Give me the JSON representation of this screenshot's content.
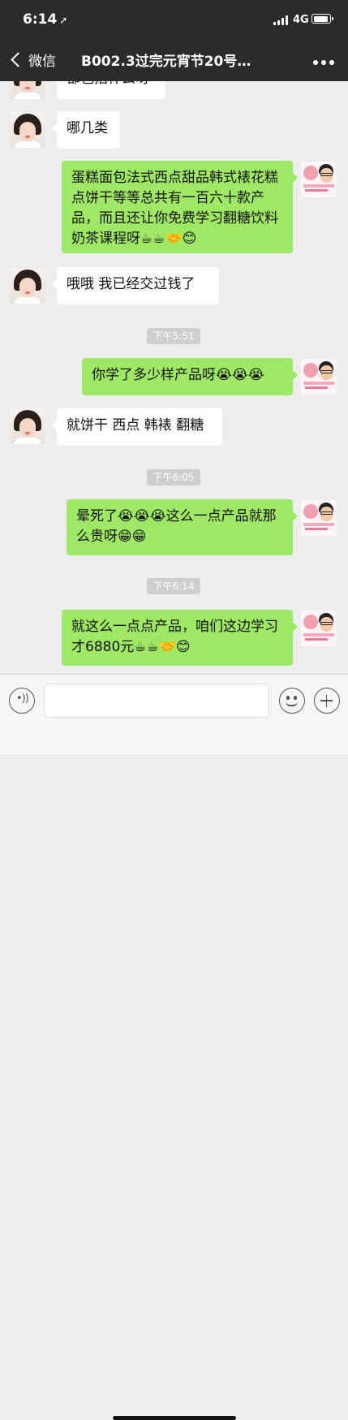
{
  "status_bar": {
    "time": "6:14",
    "network": "4G"
  },
  "nav": {
    "back_label": "微信",
    "title": "B002.3过完元宵节20号…"
  },
  "messages": [
    {
      "side": "left",
      "text": "都包括什么呀"
    },
    {
      "side": "left",
      "text": "哪几类"
    },
    {
      "side": "right",
      "text": "蛋糕面包法式西点甜品韩式裱花糕点饼干等等总共有一百六十款产品，而且还让你免费学习翻糖饮料奶茶课程呀☕☕🤝😊"
    },
    {
      "side": "left",
      "text": "哦哦  我已经交过钱了"
    },
    {
      "side": "right",
      "text": "你学了多少样产品呀😭😭😭"
    },
    {
      "side": "left",
      "text": "就饼干 西点 韩裱 翻糖"
    },
    {
      "side": "right",
      "text": "晕死了😭😭😭这么一点产品就那么贵呀😁😁"
    },
    {
      "side": "right",
      "text": "就这么一点点产品，咱们这边学习才6880元☕☕🤝😊"
    }
  ],
  "timestamps": [
    "下午5:51",
    "下午6:05",
    "下午6:14"
  ],
  "input": {
    "value": "",
    "placeholder": ""
  },
  "colors": {
    "header": "#2b2b2b",
    "bubble_self": "#9fe866",
    "bubble_other": "#ffffff",
    "background": "#ededed"
  },
  "icons": [
    "back-chevron-icon",
    "more-icon",
    "voice-icon",
    "emoji-icon",
    "plus-icon"
  ]
}
